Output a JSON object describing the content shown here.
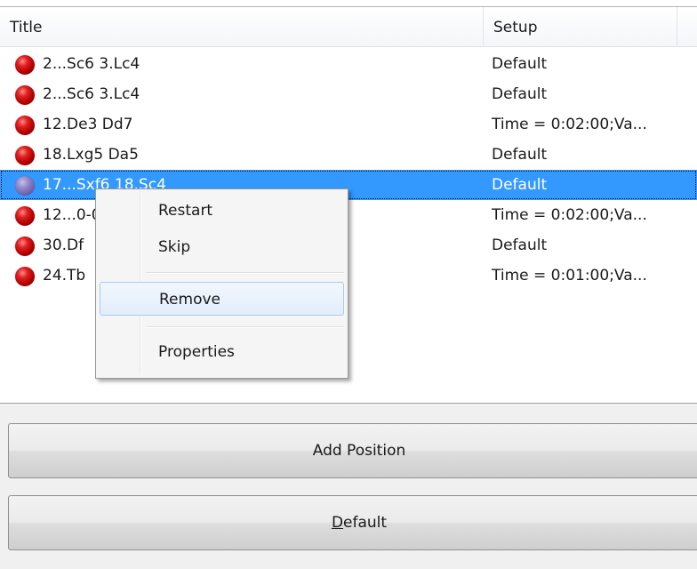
{
  "table": {
    "columns": {
      "title": "Title",
      "setup": "Setup"
    },
    "rows": [
      {
        "title": "2...Sc6 3.Lc4",
        "setup": "Default",
        "icon": "red-ball-icon"
      },
      {
        "title": "2...Sc6 3.Lc4",
        "setup": "Default",
        "icon": "red-ball-icon"
      },
      {
        "title": "12.De3 Dd7",
        "setup": "Time = 0:02:00;Va...",
        "icon": "red-ball-icon"
      },
      {
        "title": "18.Lxg5 Da5",
        "setup": "Default",
        "icon": "red-ball-icon"
      },
      {
        "title": "17...Sxf6 18.Sc4",
        "setup": "Default",
        "icon": "purple-ball-icon",
        "selected": true
      },
      {
        "title": "12...0-0",
        "setup": "Time = 0:02:00;Va...",
        "icon": "red-ball-icon"
      },
      {
        "title": "30.Df",
        "setup": "Default",
        "icon": "red-ball-icon"
      },
      {
        "title": "24.Tb",
        "setup": "Time = 0:01:00;Va...",
        "icon": "red-ball-icon"
      }
    ]
  },
  "context_menu": {
    "restart": "Restart",
    "skip": "Skip",
    "remove": "Remove",
    "properties": "Properties"
  },
  "buttons": {
    "add_position": "Add Position",
    "default_accel": "D",
    "default_rest": "efault"
  },
  "colors": {
    "selection": "#3399ff",
    "ball_red": "#c00000",
    "ball_purple": "#7a70be"
  }
}
